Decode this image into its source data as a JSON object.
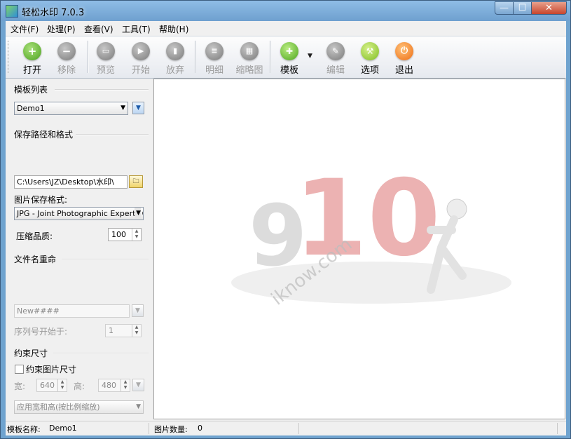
{
  "window": {
    "title": "轻松水印 7.0.3",
    "min_glyph": "—",
    "max_glyph": "☐",
    "close_glyph": "✕"
  },
  "menu": [
    "文件(F)",
    "处理(P)",
    "查看(V)",
    "工具(T)",
    "帮助(H)"
  ],
  "toolbar": {
    "open": "打开",
    "remove": "移除",
    "preview": "预览",
    "start": "开始",
    "abort": "放弃",
    "detail": "明细",
    "thumbnail": "缩略图",
    "template": "模板",
    "edit": "编辑",
    "options": "选项",
    "exit": "退出",
    "template_dropdown_glyph": "▼"
  },
  "panel": {
    "template_list": {
      "title": "模板列表",
      "selected": "Demo1"
    },
    "save": {
      "title": "保存路径和格式",
      "path": "C:\\Users\\JZ\\Desktop\\水印\\",
      "format_label": "图片保存格式:",
      "format_value": "JPG - Joint Photographic Experts Group",
      "quality_label": "压缩品质:",
      "quality_value": "100"
    },
    "rename": {
      "title": "文件名重命",
      "pattern_value": "New####",
      "seq_label": "序列号开始于:",
      "seq_value": "1"
    },
    "constrain": {
      "title": "约束尺寸",
      "checkbox_label": "约束图片尺寸",
      "checked": false,
      "width_label": "宽:",
      "width_value": "640",
      "height_label": "高:",
      "height_value": "480",
      "mode_value": "应用宽和高(按比例缩放)"
    }
  },
  "canvas": {
    "watermark_text": "iknow.com",
    "number_text": "10",
    "digit_text": "9"
  },
  "status": {
    "template_name_label": "模板名称:",
    "template_name": "Demo1",
    "image_count_label": "图片数量:",
    "image_count": "0"
  },
  "colors": {
    "green": "#5fb52a",
    "gray": "#7d7d7d",
    "orange": "#f07a1b",
    "title_bar": "#7aaad7"
  }
}
